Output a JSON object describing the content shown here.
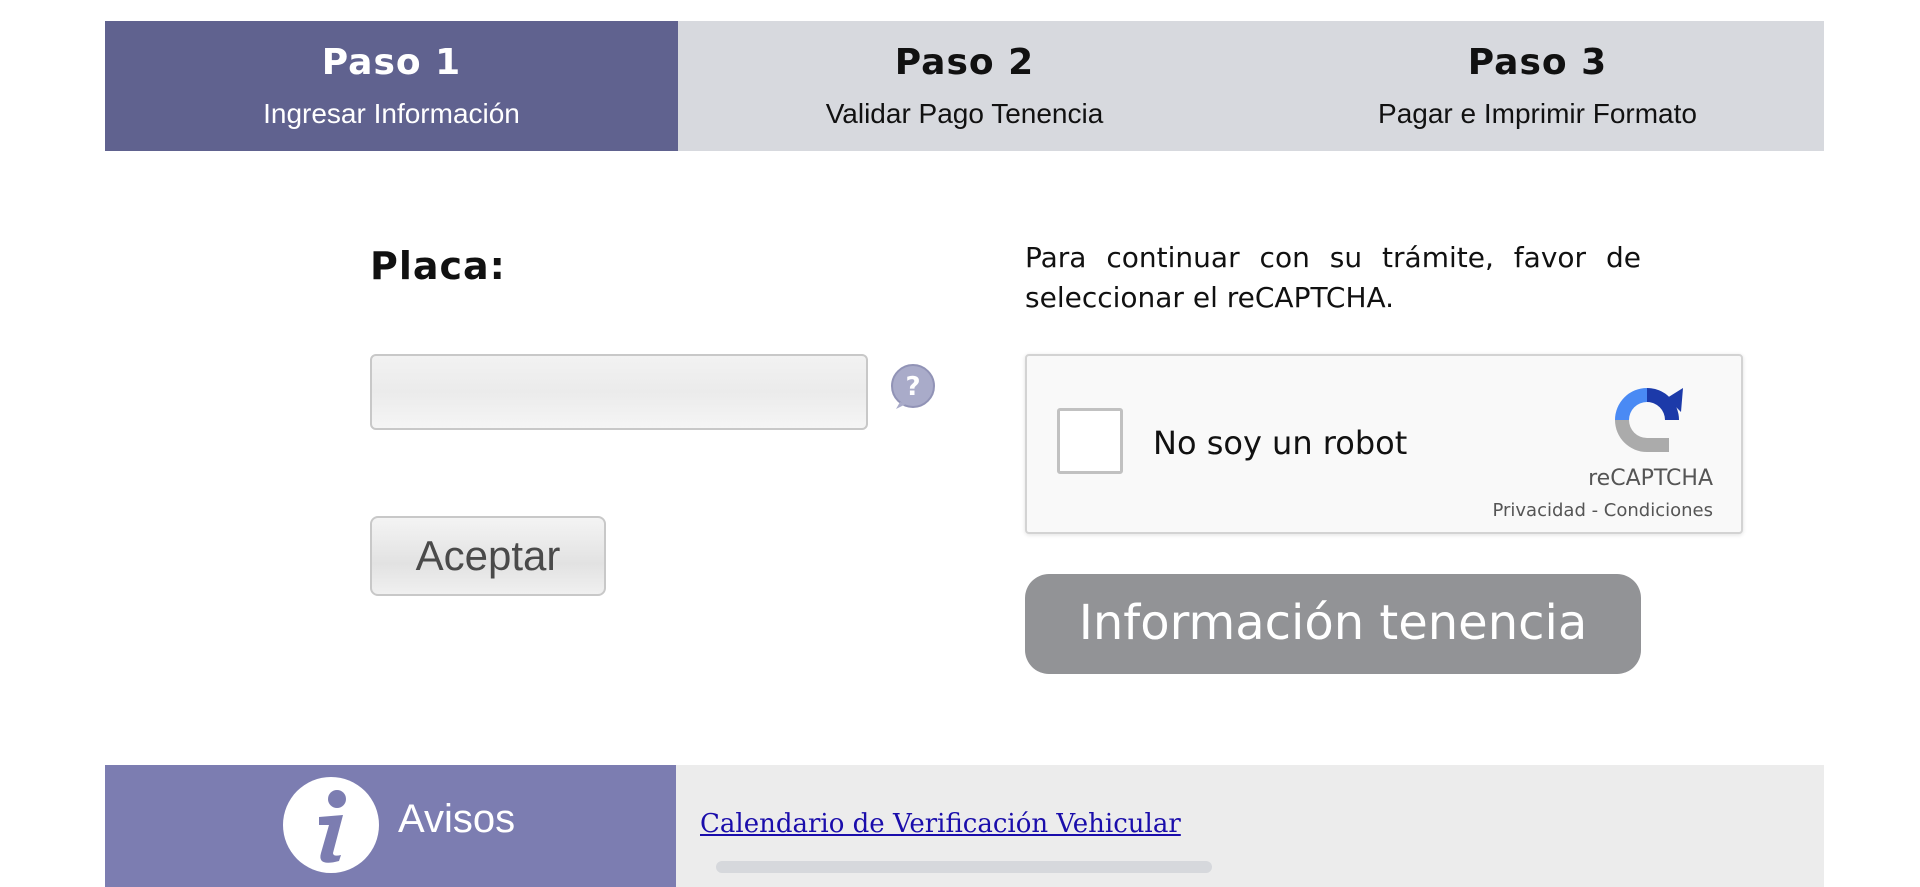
{
  "steps": [
    {
      "title": "Paso 1",
      "subtitle": "Ingresar Información"
    },
    {
      "title": "Paso 2",
      "subtitle": "Validar Pago Tenencia"
    },
    {
      "title": "Paso 3",
      "subtitle": "Pagar e Imprimir Formato"
    }
  ],
  "form": {
    "placa_label": "Placa:",
    "placa_value": "",
    "accept_label": "Aceptar"
  },
  "captcha": {
    "instructions": "Para continuar con su trámite, favor de seleccionar el reCAPTCHA.",
    "label": "No soy un robot",
    "brand": "reCAPTCHA",
    "links": "Privacidad - Condiciones"
  },
  "info_button": "Información tenencia",
  "avisos": {
    "label": "Avisos",
    "link": "Calendario de Verificación Vehicular"
  },
  "colors": {
    "active_step": "#60628f",
    "inactive_step": "#d7d9de",
    "avisos_bg": "#7c7db1",
    "info_button": "#929396"
  }
}
